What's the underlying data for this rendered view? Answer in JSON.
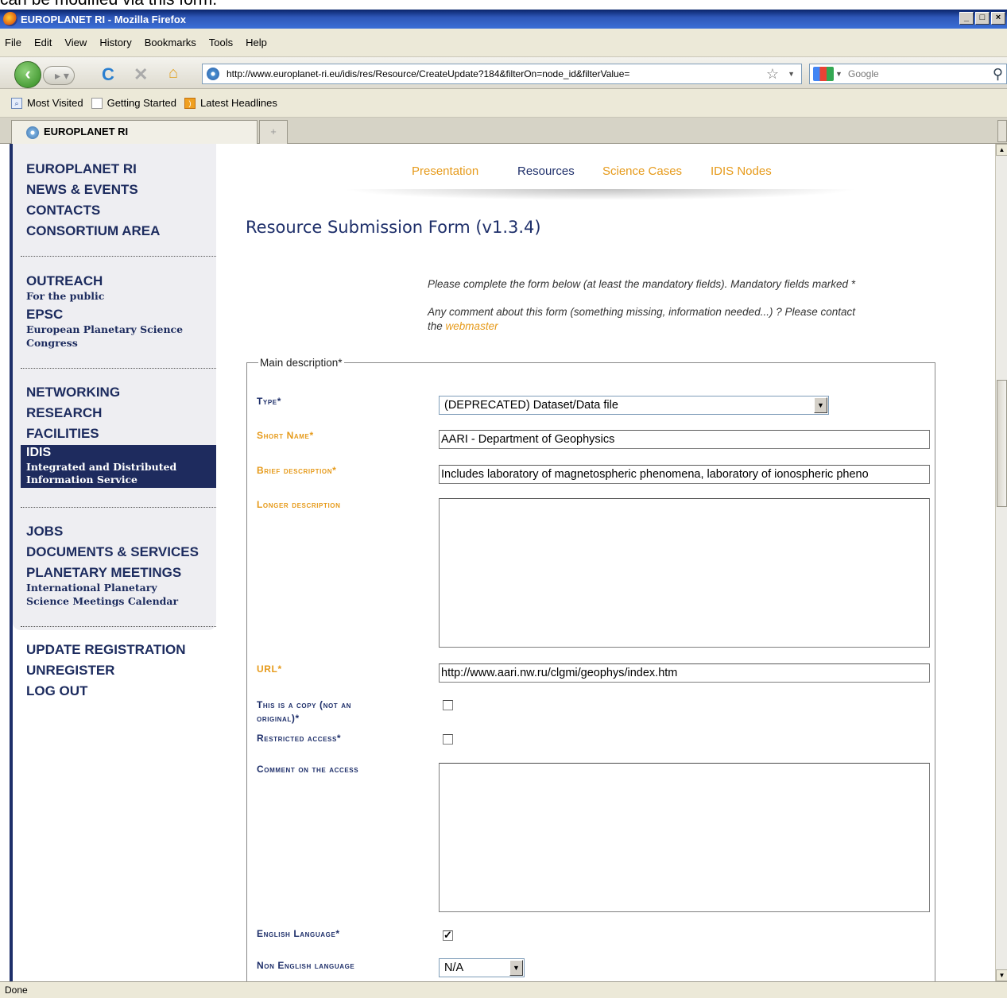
{
  "caption": "can be modified via this form.",
  "window": {
    "title": "EUROPLANET RI - Mozilla Firefox",
    "buttons": [
      "_",
      "□",
      "×"
    ]
  },
  "menu": [
    "File",
    "Edit",
    "View",
    "History",
    "Bookmarks",
    "Tools",
    "Help"
  ],
  "navbar": {
    "url": "http://www.europlanet-ri.eu/idis/res/Resource/CreateUpdate?184&filterOn=node_id&filterValue=",
    "search_placeholder": "Google"
  },
  "bookmarks": [
    "Most Visited",
    "Getting Started",
    "Latest Headlines"
  ],
  "tab": {
    "label": "EUROPLANET RI",
    "new_tab": "+"
  },
  "sidebar": {
    "group1": [
      "EUROPLANET RI",
      "NEWS & EVENTS",
      "CONTACTS",
      "CONSORTIUM AREA"
    ],
    "outreach": {
      "label": "OUTREACH",
      "sub": "For the public"
    },
    "epsc": {
      "label": "EPSC",
      "sub": "European Planetary Science Congress"
    },
    "group3": [
      "NETWORKING",
      "RESEARCH",
      "FACILITIES"
    ],
    "idis": {
      "label": "IDIS",
      "sub": "Integrated and Distributed Information Service"
    },
    "group4": [
      "JOBS",
      "DOCUMENTS & SERVICES"
    ],
    "meetings": {
      "label": "PLANETARY MEETINGS",
      "sub": "International Planetary Science Meetings Calendar"
    },
    "group5": [
      "UPDATE REGISTRATION",
      "UNREGISTER",
      "LOG OUT"
    ]
  },
  "topnav": [
    "Presentation",
    "Resources",
    "Science Cases",
    "IDIS Nodes"
  ],
  "form": {
    "title": "Resource Submission Form (v1.3.4)",
    "info1": "Please complete the form below (at least the mandatory fields). Mandatory fields marked *",
    "info2": "Any comment about this form (something missing, information needed...) ? Please contact",
    "info2_the": "the",
    "info2_link": "webmaster",
    "legend": "Main description*",
    "type_label": "Type*",
    "type_value": "(DEPRECATED) Dataset/Data file",
    "shortname_label": "Short Name*",
    "shortname_value": "AARI - Department of Geophysics",
    "brief_label": "Brief description*",
    "brief_value": "Includes laboratory of magnetospheric phenomena, laboratory of ionospheric pheno",
    "longer_label": "Longer description",
    "url_label": "URL*",
    "url_value": "http://www.aari.nw.ru/clgmi/geophys/index.htm",
    "copy_label_1": "This is a copy (not an",
    "copy_label_2": "original)*",
    "copy_checked": false,
    "restricted_label": "Restricted access*",
    "restricted_checked": false,
    "comment_label": "Comment on the access",
    "english_label": "English Language*",
    "english_checked": true,
    "nonenglish_label": "Non English language",
    "nonenglish_value": "N/A"
  },
  "status": "Done",
  "colors": {
    "accent_orange": "#e69a1a",
    "navy": "#1e2f6a"
  }
}
